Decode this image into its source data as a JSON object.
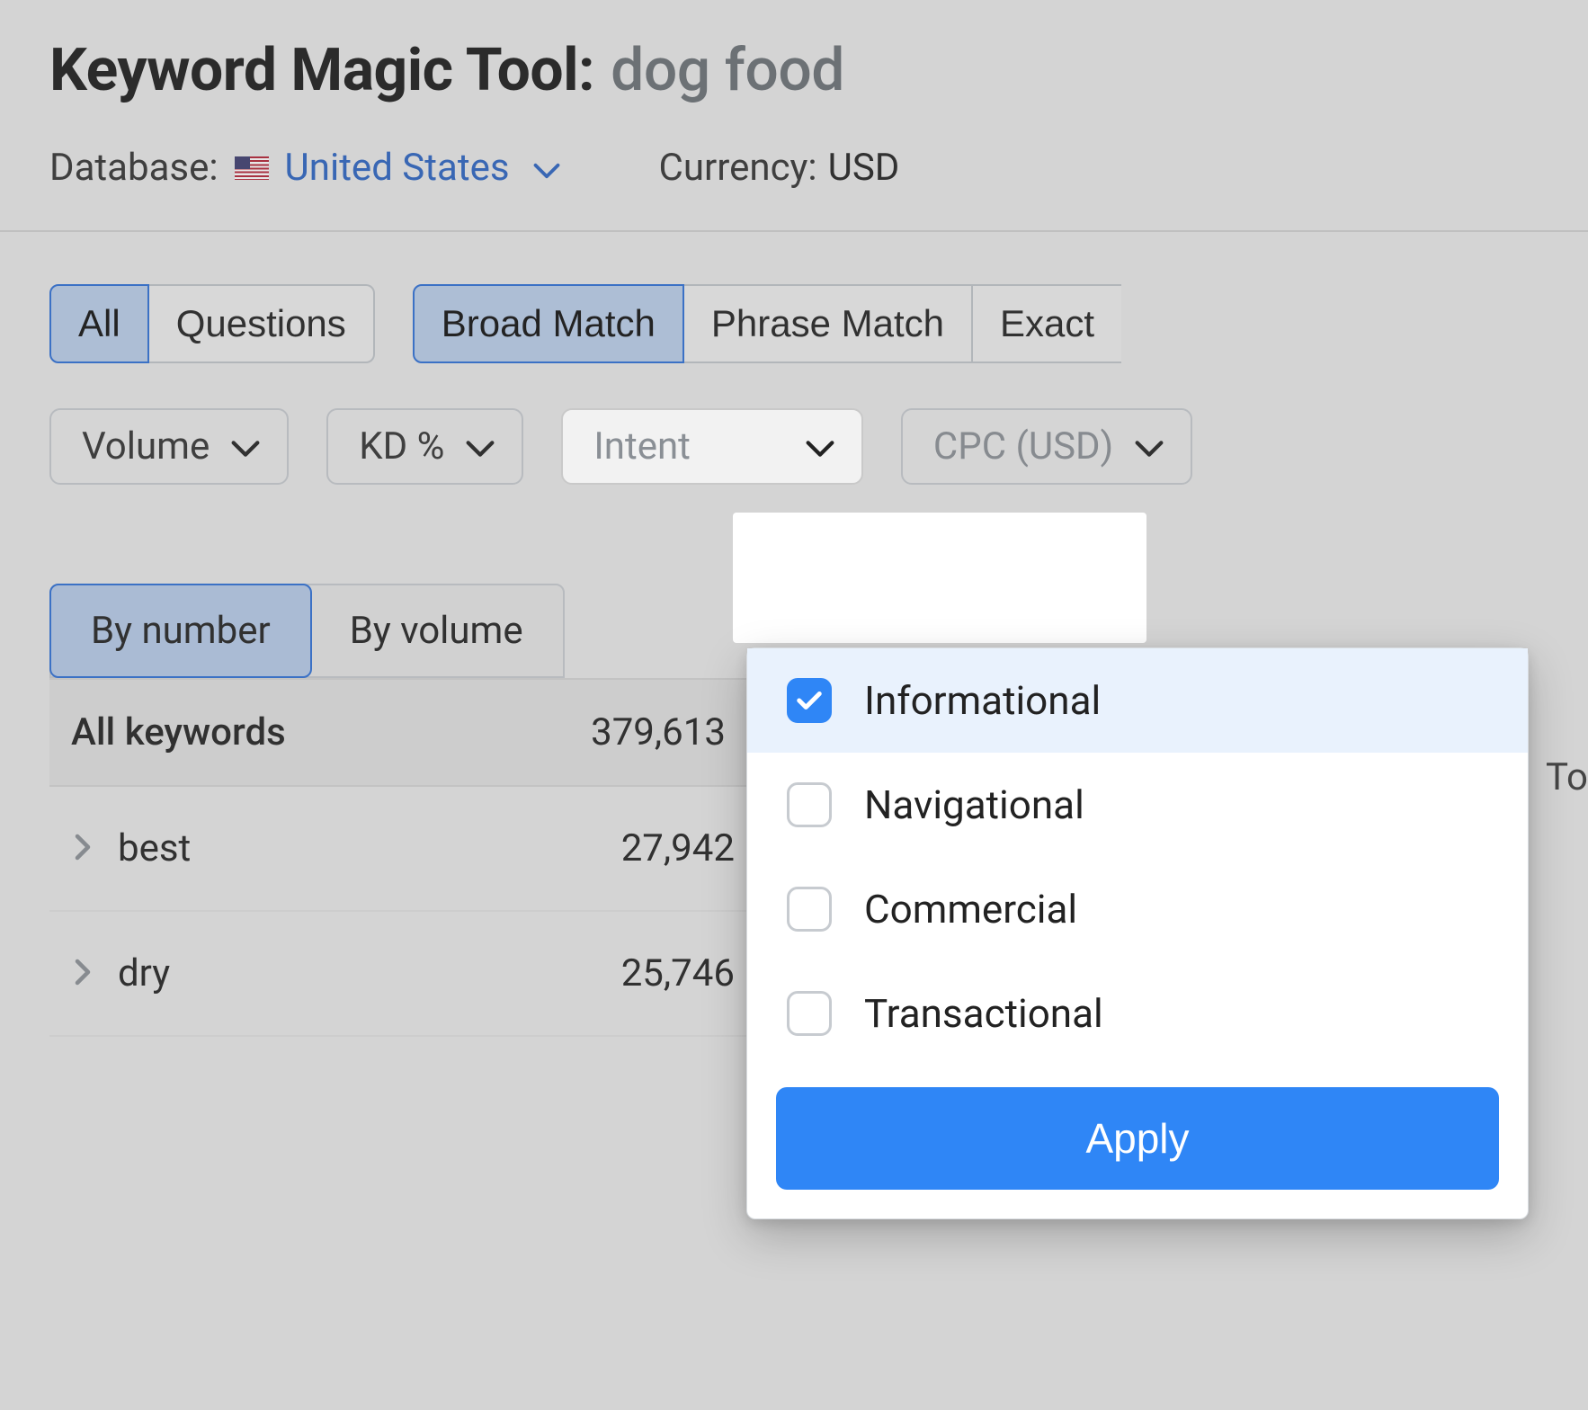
{
  "header": {
    "title_label": "Keyword Magic Tool:",
    "query": "dog food",
    "database_label": "Database:",
    "database_value": "United States",
    "currency_label": "Currency:",
    "currency_value": "USD"
  },
  "tabs_primary": {
    "all": "All",
    "questions": "Questions"
  },
  "tabs_match": {
    "broad": "Broad Match",
    "phrase": "Phrase Match",
    "exact": "Exact"
  },
  "filters": {
    "volume": "Volume",
    "kd": "KD %",
    "intent": "Intent",
    "cpc": "CPC (USD)"
  },
  "sort_tabs": {
    "by_number": "By number",
    "by_volume": "By volume"
  },
  "keywords": {
    "all_label": "All keywords",
    "all_count": "379,613",
    "rows": [
      {
        "name": "best",
        "count": "27,942"
      },
      {
        "name": "dry",
        "count": "25,746"
      }
    ]
  },
  "intent_dropdown": {
    "options": [
      {
        "label": "Informational",
        "checked": true
      },
      {
        "label": "Navigational",
        "checked": false
      },
      {
        "label": "Commercial",
        "checked": false
      },
      {
        "label": "Transactional",
        "checked": false
      }
    ],
    "apply": "Apply"
  },
  "fragment_to": "To"
}
